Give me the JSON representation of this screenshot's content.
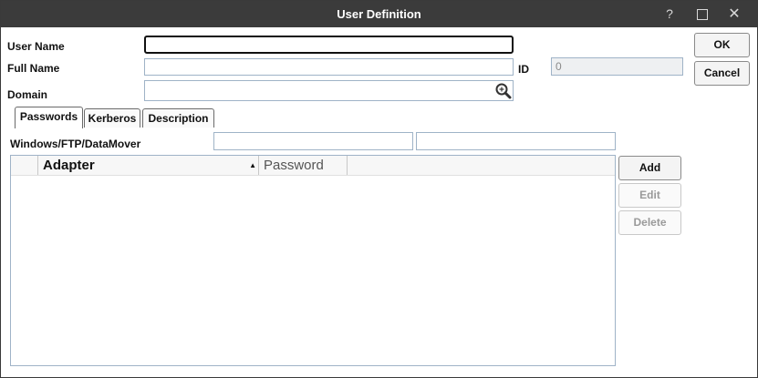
{
  "window": {
    "title": "User Definition",
    "help_label": "?",
    "close_label": "✕"
  },
  "form": {
    "user_name_label": "User Name",
    "user_name_value": "",
    "full_name_label": "Full Name",
    "full_name_value": "",
    "id_label": "ID",
    "id_value": "0",
    "domain_label": "Domain",
    "domain_value": ""
  },
  "buttons": {
    "ok": "OK",
    "cancel": "Cancel",
    "add": "Add",
    "edit": "Edit",
    "delete": "Delete"
  },
  "tabs": [
    {
      "label": "Passwords",
      "active": true
    },
    {
      "label": "Kerberos",
      "active": false
    },
    {
      "label": "Description",
      "active": false
    }
  ],
  "passwords": {
    "windows_label": "Windows/FTP/DataMover",
    "windows_value_1": "",
    "windows_value_2": ""
  },
  "grid": {
    "columns": [
      "",
      "Adapter",
      "Password"
    ],
    "sort_indicator": "▲",
    "rows": []
  }
}
